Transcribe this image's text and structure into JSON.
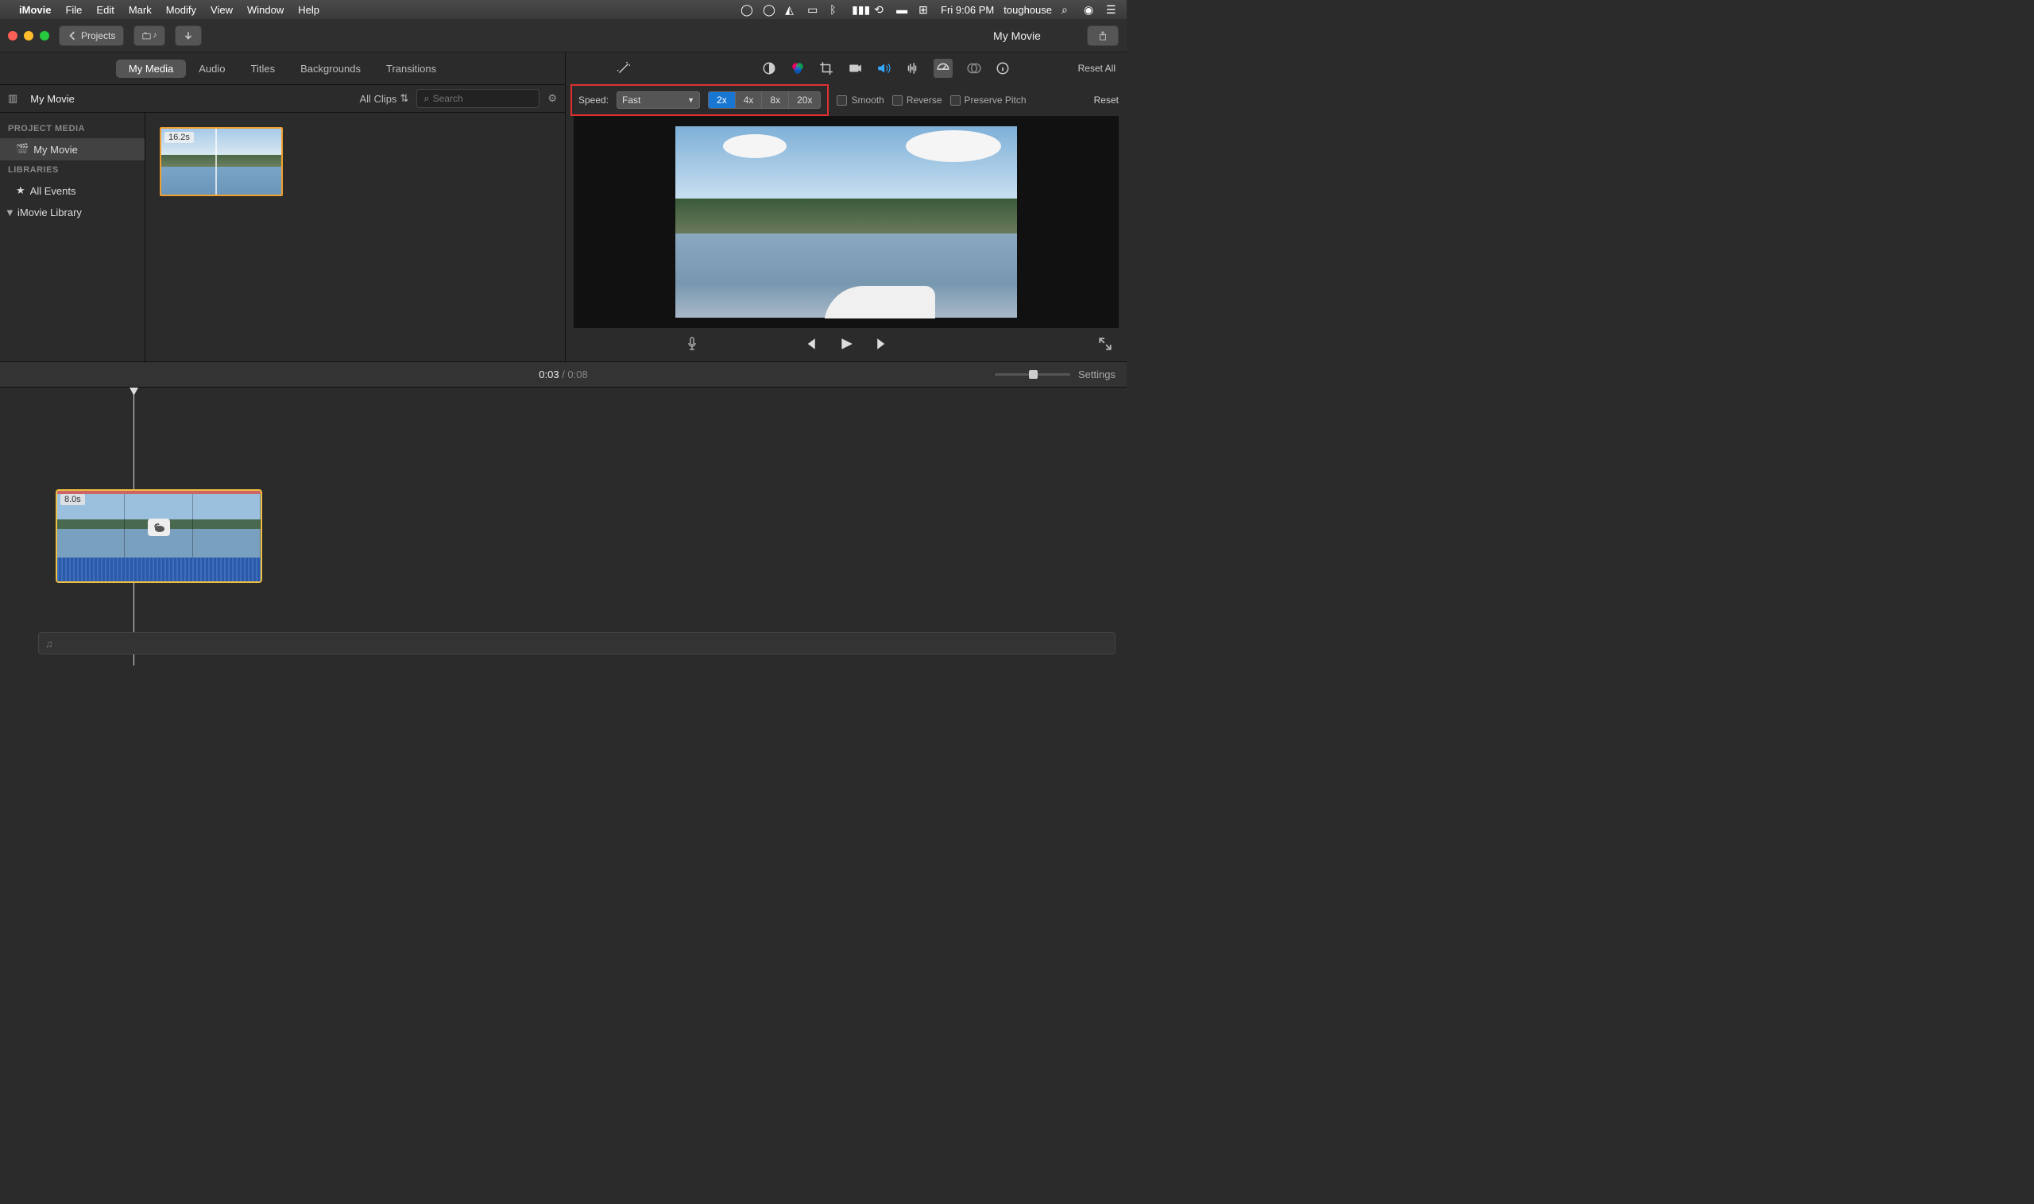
{
  "menubar": {
    "app": "iMovie",
    "items": [
      "File",
      "Edit",
      "Mark",
      "Modify",
      "View",
      "Window",
      "Help"
    ],
    "clock": "Fri 9:06 PM",
    "user": "toughouse"
  },
  "titlebar": {
    "projects": "Projects",
    "title": "My Movie"
  },
  "browser_tabs": {
    "my_media": "My Media",
    "audio": "Audio",
    "titles": "Titles",
    "backgrounds": "Backgrounds",
    "transitions": "Transitions"
  },
  "browser_bar": {
    "project_name": "My Movie",
    "all_clips": "All Clips",
    "search_placeholder": "Search"
  },
  "sidebar": {
    "project_media_hdr": "PROJECT MEDIA",
    "my_movie": "My Movie",
    "libraries_hdr": "LIBRARIES",
    "all_events": "All Events",
    "imovie_library": "iMovie Library"
  },
  "media": {
    "clip_duration": "16.2s"
  },
  "adjust": {
    "reset_all": "Reset All"
  },
  "speed": {
    "label": "Speed:",
    "select_value": "Fast",
    "x2": "2x",
    "x4": "4x",
    "x8": "8x",
    "x20": "20x",
    "smooth": "Smooth",
    "reverse": "Reverse",
    "preserve": "Preserve Pitch",
    "reset": "Reset"
  },
  "timeline_hdr": {
    "current": "0:03",
    "sep": " / ",
    "total": "0:08",
    "settings": "Settings"
  },
  "timeline": {
    "clip_duration": "8.0s"
  }
}
